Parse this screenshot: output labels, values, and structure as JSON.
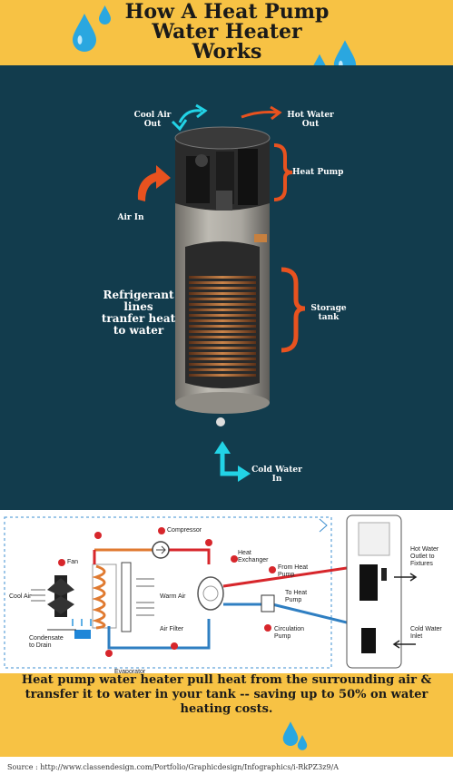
{
  "header": {
    "title_lines": [
      "How A Heat Pump",
      "Water Heater",
      "Works"
    ]
  },
  "hero": {
    "labels": {
      "cool_air_out": [
        "Cool Air",
        "Out"
      ],
      "hot_water_out": [
        "Hot Water",
        "Out"
      ],
      "heat_pump": "Heat Pump",
      "air_in": "Air In",
      "refrigerant": [
        "Refrigerant",
        "lines",
        "tranfer heat",
        "to water"
      ],
      "storage_tank": [
        "Storage",
        "tank"
      ],
      "cold_water_in": [
        "Cold Water",
        "In"
      ]
    }
  },
  "schematic": {
    "labels": {
      "fan": "Fan",
      "compressor": "Compressor",
      "heat_exchanger": [
        "Heat",
        "Exchanger"
      ],
      "from_heat_pump": [
        "From Heat",
        "Pump"
      ],
      "to_heat_pump": [
        "To Heat",
        "Pump"
      ],
      "cool_air": "Cool Air",
      "warm_air": "Warm Air",
      "air_filter": "Air Filter",
      "condensate": [
        "Condensate",
        "to Drain"
      ],
      "evaporator": "Evaporator",
      "circulation_pump": [
        "Circulation",
        "Pump"
      ],
      "hot_water_outlet": [
        "Hot Water",
        "Outlet to",
        "Fixtures"
      ],
      "cold_water_inlet": [
        "Cold Water",
        "Inlet"
      ]
    },
    "badges": [
      "1",
      "2",
      "3",
      "4",
      "5",
      "6",
      "7",
      "8",
      "9"
    ]
  },
  "footer": {
    "text_lines": [
      "Heat pump water heater pull heat from the surrounding air &",
      "transfer it to water in your tank -- saving up to 50% on  water",
      "heating costs."
    ]
  },
  "source": "Source : http://www.classendesign.com/Portfolio/Graphicdesign/Infographics/i-RkPZ3z9/A",
  "colors": {
    "banner": "#f7c244",
    "hero_bg": "#123c4d",
    "arrow_orange": "#e8521f",
    "arrow_cyan": "#22d3e6",
    "drop_blue": "#2aa7e0",
    "pipe_red": "#d7262b",
    "pipe_blue": "#2f7fc2"
  },
  "icons": [
    "water-drop-icon",
    "curved-arrow-icon",
    "brace-icon",
    "fan-icon",
    "compressor-icon",
    "pump-icon"
  ]
}
